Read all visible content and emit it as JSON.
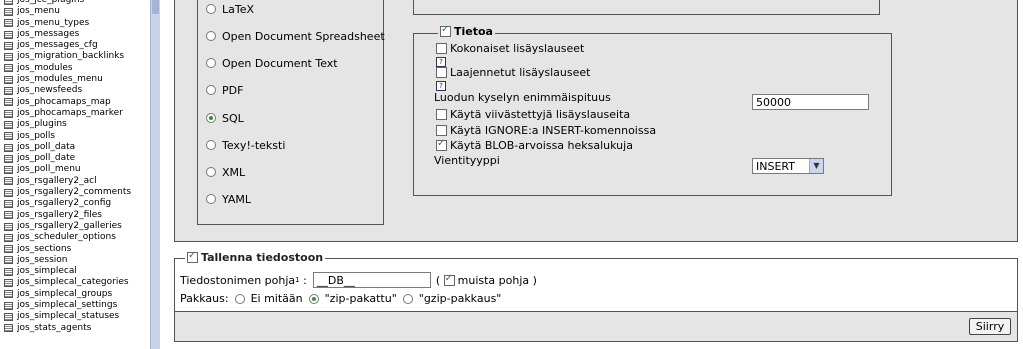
{
  "sidebar": {
    "tables": [
      "jos_jce_plugins",
      "jos_menu",
      "jos_menu_types",
      "jos_messages",
      "jos_messages_cfg",
      "jos_migration_backlinks",
      "jos_modules",
      "jos_modules_menu",
      "jos_newsfeeds",
      "jos_phocamaps_map",
      "jos_phocamaps_marker",
      "jos_plugins",
      "jos_polls",
      "jos_poll_data",
      "jos_poll_date",
      "jos_poll_menu",
      "jos_rsgallery2_acl",
      "jos_rsgallery2_comments",
      "jos_rsgallery2_config",
      "jos_rsgallery2_files",
      "jos_rsgallery2_galleries",
      "jos_scheduler_options",
      "jos_sections",
      "jos_session",
      "jos_simplecal",
      "jos_simplecal_categories",
      "jos_simplecal_groups",
      "jos_simplecal_settings",
      "jos_simplecal_statuses",
      "jos_stats_agents"
    ]
  },
  "formats": {
    "options": [
      "LaTeX",
      "Open Document Spreadsheet",
      "Open Document Text",
      "PDF",
      "SQL",
      "Texy!-teksti",
      "XML",
      "YAML"
    ],
    "selected": "SQL"
  },
  "data_options": {
    "legend": "Tietoa",
    "legend_checked": true,
    "complete_inserts": "Kokonaiset lisäyslauseet",
    "extended_inserts": "Laajennetut lisäyslauseet",
    "help_glyph": "?",
    "max_query_label": "Luodun kyselyn enimmäispituus",
    "max_query_value": "50000",
    "delayed_inserts": "Käytä viivästettyjä lisäyslauseita",
    "ignore_inserts": "Käytä IGNORE:a INSERT-komennoissa",
    "hex_blob": "Käytä BLOB-arvoissa heksalukuja",
    "export_type_label": "Vientityyppi",
    "export_type_value": "INSERT"
  },
  "save": {
    "legend": "Tallenna tiedostoon",
    "filename_label": "Tiedostonimen pohja",
    "filename_sup": "1",
    "filename_colon": ":",
    "filename_value": "__DB__",
    "open_paren": "(",
    "remember_label": "muista pohja )",
    "compression_label": "Pakkaus:",
    "compression_options": [
      "Ei mitään",
      "\"zip-pakattu\"",
      "\"gzip-pakkaus\""
    ],
    "compression_selected": "\"zip-pakattu\"",
    "go_button": "Siirry"
  },
  "colors": {
    "panel_bg": "#e5e5e5",
    "scrollbar": "#c9d4ea",
    "check_green": "#2d7d2d"
  }
}
